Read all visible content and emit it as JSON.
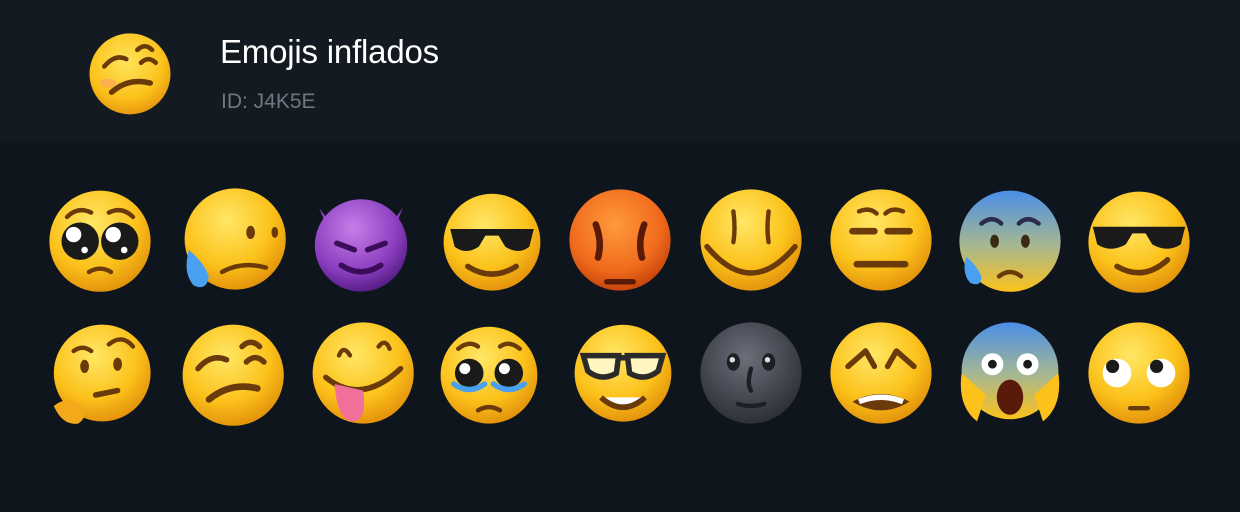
{
  "pack": {
    "title": "Emojis inflados",
    "id_text": "ID: J4K5E",
    "icon": "woozy-face-icon"
  },
  "colors": {
    "background": "#0f151d",
    "header_background": "#131a22",
    "title": "#ffffff",
    "subtitle": "#6f7780"
  },
  "emojis": [
    [
      "pleading-face-icon",
      "sad-tear-face-icon",
      "smiling-imp-icon",
      "smiling-sunglasses-face-icon",
      "pouting-face-icon",
      "wide-smile-face-icon",
      "expressionless-face-icon",
      "anxious-sweat-face-icon",
      "cool-sunglasses-face-icon"
    ],
    [
      "thinking-face-icon",
      "woozy-face-icon",
      "tongue-out-face-icon",
      "holding-back-tears-face-icon",
      "nerd-glasses-face-icon",
      "new-moon-face-icon",
      "tired-face-icon",
      "screaming-face-icon",
      "eyes-up-face-icon"
    ]
  ]
}
